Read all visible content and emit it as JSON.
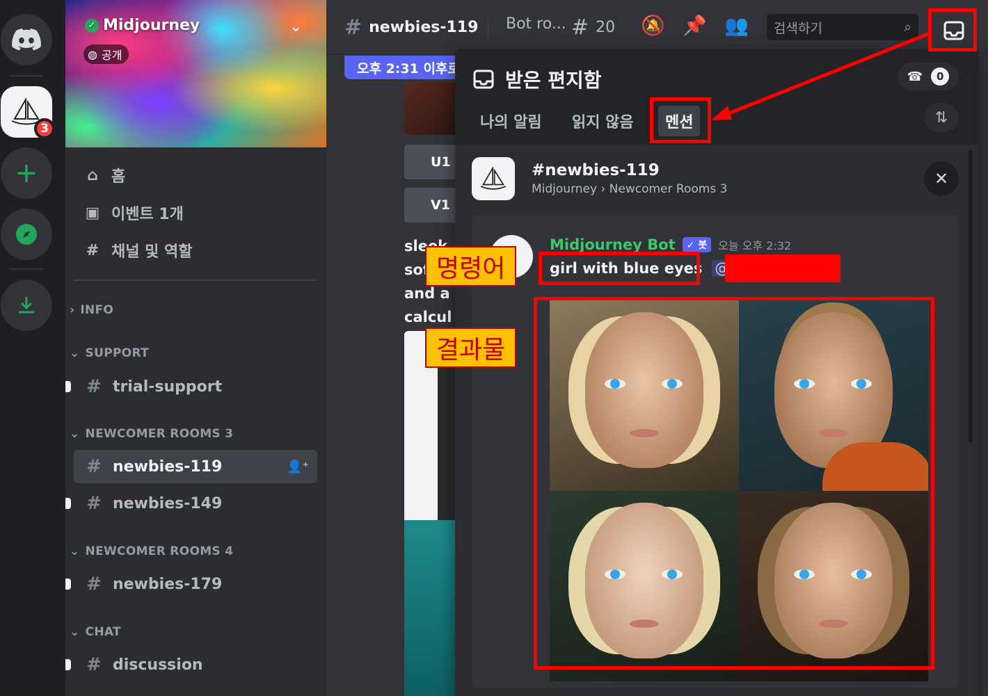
{
  "server": {
    "name": "Midjourney",
    "visibility": "공개",
    "badge_count": "3"
  },
  "sidebar": {
    "nav": [
      {
        "label": "홈"
      },
      {
        "label": "이벤트 1개"
      },
      {
        "label": "채널 및 역할"
      }
    ],
    "categories": {
      "info": "INFO",
      "support": "SUPPORT",
      "newcomer3": "NEWCOMER ROOMS 3",
      "newcomer4": "NEWCOMER ROOMS 4",
      "chat": "CHAT"
    },
    "channels": {
      "trial_support": "trial-support",
      "newbies_119": "newbies-119",
      "newbies_149": "newbies-149",
      "newbies_179": "newbies-179",
      "discussion": "discussion"
    }
  },
  "topbar": {
    "channel": "newbies-119",
    "topic": "Bot ro...",
    "threads_count": "20",
    "search_placeholder": "검색하기"
  },
  "chat": {
    "new_messages": "오후 2:31 이후로",
    "u1": "U1",
    "v1": "V1",
    "lines": [
      "sleek",
      "sof",
      "and a g",
      "calcul"
    ]
  },
  "inbox": {
    "title": "받은 편지함",
    "call_count": "0",
    "tabs": [
      "나의 알림",
      "읽지 않음",
      "멘션"
    ],
    "mention": {
      "channel": "newbies-119",
      "path": "Midjourney › Newcomer Rooms 3",
      "author": "Midjourney Bot",
      "bot_tag": "✓ 봇",
      "time": "오늘 오후 2:32",
      "prompt": "girl with blue eyes",
      "mention_prefix": "@"
    }
  },
  "annotations": {
    "command_label": "명령어",
    "result_label": "결과물"
  },
  "colors": {
    "accent": "#5865f2",
    "annotation": "#ff0000",
    "label_bg": "#ffc000",
    "bot_name": "#3ec76b"
  }
}
